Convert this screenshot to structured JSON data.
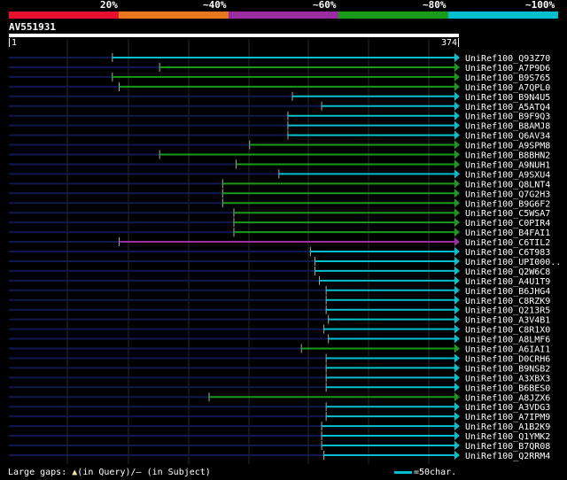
{
  "legend": {
    "labels": [
      "20%",
      "~40%",
      "~60%",
      "~80%",
      "~100%"
    ],
    "colors": [
      "#e8102e",
      "#e8781e",
      "#9a2ea0",
      "#1a9a1a",
      "#00c0d0"
    ]
  },
  "query": {
    "name": "AV551931",
    "start": "1",
    "end": "374"
  },
  "hits": [
    {
      "name": "UniRef100_Q93Z70",
      "start": 0.23,
      "color": "cyan"
    },
    {
      "name": "UniRef100_A7P9D6",
      "start": 0.335,
      "color": "green"
    },
    {
      "name": "UniRef100_B9S765",
      "start": 0.23,
      "color": "green"
    },
    {
      "name": "UniRef100_A7QPL0",
      "start": 0.245,
      "color": "green"
    },
    {
      "name": "UniRef100_B9N4U5",
      "start": 0.63,
      "color": "cyan"
    },
    {
      "name": "UniRef100_A5ATQ4",
      "start": 0.695,
      "color": "cyan"
    },
    {
      "name": "UniRef100_B9F9Q3",
      "start": 0.62,
      "color": "cyan"
    },
    {
      "name": "UniRef100_B8AMJ8",
      "start": 0.62,
      "color": "cyan"
    },
    {
      "name": "UniRef100_Q6AV34",
      "start": 0.62,
      "color": "cyan"
    },
    {
      "name": "UniRef100_A9SPM8",
      "start": 0.535,
      "color": "green"
    },
    {
      "name": "UniRef100_B8BHN2",
      "start": 0.335,
      "color": "green"
    },
    {
      "name": "UniRef100_A9NUH1",
      "start": 0.505,
      "color": "green"
    },
    {
      "name": "UniRef100_A9SXU4",
      "start": 0.6,
      "color": "cyan"
    },
    {
      "name": "UniRef100_Q8LNT4",
      "start": 0.475,
      "color": "green"
    },
    {
      "name": "UniRef100_Q7G2H3",
      "start": 0.475,
      "color": "green"
    },
    {
      "name": "UniRef100_B9G6F2",
      "start": 0.475,
      "color": "green"
    },
    {
      "name": "UniRef100_C5WSA7",
      "start": 0.5,
      "color": "green"
    },
    {
      "name": "UniRef100_C0PIR4",
      "start": 0.5,
      "color": "green"
    },
    {
      "name": "UniRef100_B4FAI1",
      "start": 0.5,
      "color": "green"
    },
    {
      "name": "UniRef100_C6TIL2",
      "start": 0.245,
      "color": "purple"
    },
    {
      "name": "UniRef100_C6T983",
      "start": 0.67,
      "color": "cyan"
    },
    {
      "name": "UniRef100_UPI000..",
      "start": 0.68,
      "color": "cyan"
    },
    {
      "name": "UniRef100_Q2W6C8",
      "start": 0.68,
      "color": "cyan"
    },
    {
      "name": "UniRef100_A4U1T9",
      "start": 0.69,
      "color": "cyan"
    },
    {
      "name": "UniRef100_B6JHG4",
      "start": 0.705,
      "color": "cyan"
    },
    {
      "name": "UniRef100_C8RZK9",
      "start": 0.705,
      "color": "cyan"
    },
    {
      "name": "UniRef100_Q213R5",
      "start": 0.705,
      "color": "cyan"
    },
    {
      "name": "UniRef100_A3V4B1",
      "start": 0.71,
      "color": "cyan"
    },
    {
      "name": "UniRef100_C8R1X0",
      "start": 0.7,
      "color": "cyan"
    },
    {
      "name": "UniRef100_A8LMF6",
      "start": 0.71,
      "color": "cyan"
    },
    {
      "name": "UniRef100_A6IAI1",
      "start": 0.65,
      "color": "green"
    },
    {
      "name": "UniRef100_D0CRH6",
      "start": 0.705,
      "color": "cyan"
    },
    {
      "name": "UniRef100_B9NSB2",
      "start": 0.705,
      "color": "cyan"
    },
    {
      "name": "UniRef100_A3XBX3",
      "start": 0.705,
      "color": "cyan"
    },
    {
      "name": "UniRef100_B6BES0",
      "start": 0.705,
      "color": "cyan"
    },
    {
      "name": "UniRef100_A8JZX6",
      "start": 0.445,
      "color": "green"
    },
    {
      "name": "UniRef100_A3VDG3",
      "start": 0.705,
      "color": "cyan"
    },
    {
      "name": "UniRef100_A7IPM9",
      "start": 0.705,
      "color": "cyan"
    },
    {
      "name": "UniRef100_A1B2K9",
      "start": 0.695,
      "color": "cyan"
    },
    {
      "name": "UniRef100_Q1YMK2",
      "start": 0.695,
      "color": "cyan"
    },
    {
      "name": "UniRef100_B7QR08",
      "start": 0.695,
      "color": "cyan"
    },
    {
      "name": "UniRef100_Q2RRM4",
      "start": 0.7,
      "color": "cyan"
    }
  ],
  "footer": {
    "large_gaps_label": "Large gaps:",
    "in_query": "(in Query)/",
    "dash": "—",
    "in_subject": " (in Subject)",
    "scale_text": "=50char."
  }
}
